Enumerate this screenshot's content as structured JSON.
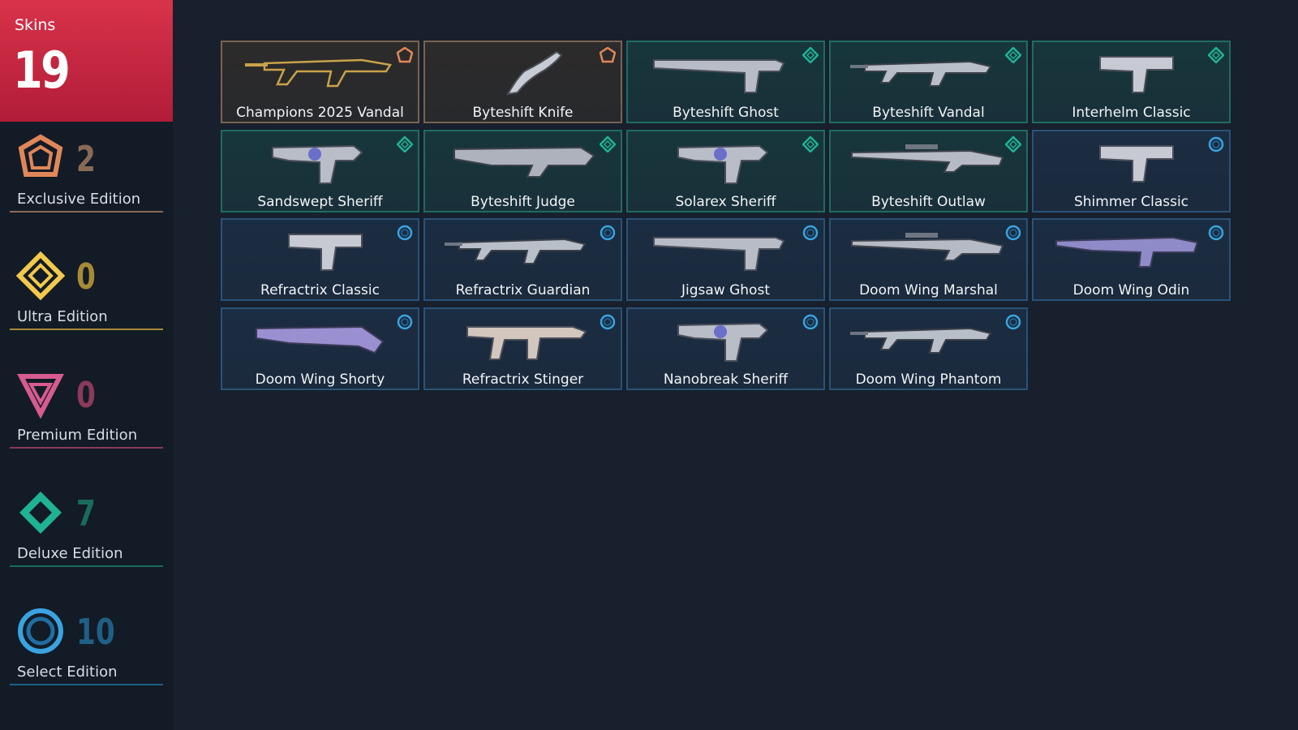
{
  "total": {
    "label": "Skins",
    "count": "19"
  },
  "tiers": [
    {
      "name": "Exclusive Edition",
      "count": "2",
      "color": "#e0875a",
      "count_color": "#8a6a55"
    },
    {
      "name": "Ultra Edition",
      "count": "0",
      "color": "#f2c94c",
      "count_color": "#a68a36"
    },
    {
      "name": "Premium Edition",
      "count": "0",
      "color": "#d65b8e",
      "count_color": "#8a3a5a"
    },
    {
      "name": "Deluxe Edition",
      "count": "7",
      "color": "#1fb394",
      "count_color": "#1a6b5e"
    },
    {
      "name": "Select Edition",
      "count": "10",
      "color": "#3aa3e0",
      "count_color": "#1f5f85"
    }
  ],
  "skins": [
    {
      "name": "Champions 2025 Vandal",
      "tier": "exclusive",
      "icon": "rifle-gold"
    },
    {
      "name": "Byteshift Knife",
      "tier": "exclusive",
      "icon": "knife"
    },
    {
      "name": "Byteshift Ghost",
      "tier": "deluxe",
      "icon": "pistol-silenced"
    },
    {
      "name": "Byteshift Vandal",
      "tier": "deluxe",
      "icon": "rifle"
    },
    {
      "name": "Interhelm Classic",
      "tier": "deluxe",
      "icon": "pistol"
    },
    {
      "name": "Sandswept Sheriff",
      "tier": "deluxe",
      "icon": "revolver"
    },
    {
      "name": "Byteshift Judge",
      "tier": "deluxe",
      "icon": "shotgun"
    },
    {
      "name": "Solarex Sheriff",
      "tier": "deluxe",
      "icon": "revolver"
    },
    {
      "name": "Byteshift Outlaw",
      "tier": "deluxe",
      "icon": "sniper"
    },
    {
      "name": "Shimmer Classic",
      "tier": "select",
      "icon": "pistol"
    },
    {
      "name": "Refractrix Classic",
      "tier": "select",
      "icon": "pistol"
    },
    {
      "name": "Refractrix Guardian",
      "tier": "select",
      "icon": "rifle"
    },
    {
      "name": "Jigsaw Ghost",
      "tier": "select",
      "icon": "pistol-silenced"
    },
    {
      "name": "Doom Wing Marshal",
      "tier": "select",
      "icon": "sniper"
    },
    {
      "name": "Doom Wing Odin",
      "tier": "select",
      "icon": "machinegun"
    },
    {
      "name": "Doom Wing Shorty",
      "tier": "select",
      "icon": "shotgun-short"
    },
    {
      "name": "Refractrix Stinger",
      "tier": "select",
      "icon": "smg"
    },
    {
      "name": "Nanobreak Sheriff",
      "tier": "select",
      "icon": "revolver"
    },
    {
      "name": "Doom Wing Phantom",
      "tier": "select",
      "icon": "rifle"
    }
  ]
}
